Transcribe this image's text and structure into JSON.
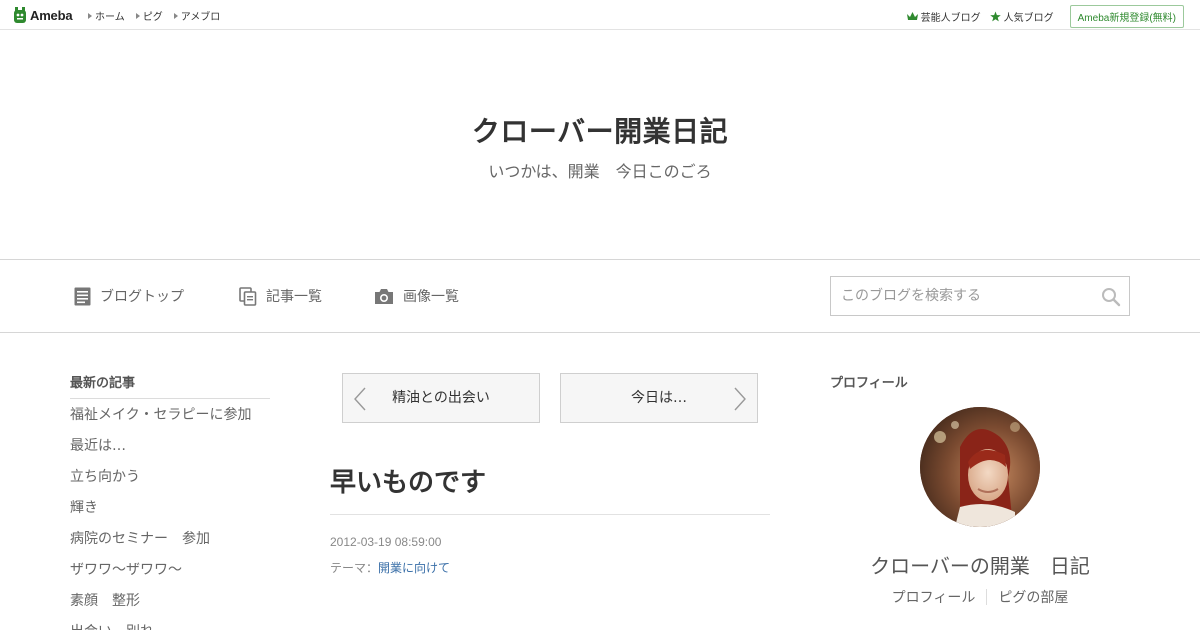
{
  "topbar": {
    "logo_text": "Ameba",
    "nav": [
      "ホーム",
      "ピグ",
      "アメブロ"
    ],
    "celebrity_blog": "芸能人ブログ",
    "popular_blog": "人気ブログ",
    "register": "Ameba新規登録(無料)"
  },
  "header": {
    "title": "クローバー開業日記",
    "description": "いつかは、開業　今日このごろ"
  },
  "navbar": {
    "blog_top": "ブログトップ",
    "entry_list": "記事一覧",
    "image_list": "画像一覧",
    "search_placeholder": "このブログを検索する"
  },
  "recent": {
    "title": "最新の記事",
    "items": [
      "福祉メイク・セラピーに参加",
      "最近は…",
      "立ち向かう",
      "輝き",
      "病院のセミナー　参加",
      "ザワワ～ザワワ～",
      "素顔　整形",
      "出会い　別れ"
    ]
  },
  "pager": {
    "prev": "精油との出会い",
    "next": "今日は…"
  },
  "entry": {
    "title": "早いものです",
    "date": "2012-03-19 08:59:00",
    "theme_label": "テーマ：",
    "theme": "開業に向けて"
  },
  "profile": {
    "title": "プロフィール",
    "name": "クローバーの開業　日記",
    "link_profile": "プロフィール",
    "link_room": "ピグの部屋"
  },
  "colors": {
    "accent_green": "#2f8a2f",
    "link_blue": "#3a6fa8"
  }
}
